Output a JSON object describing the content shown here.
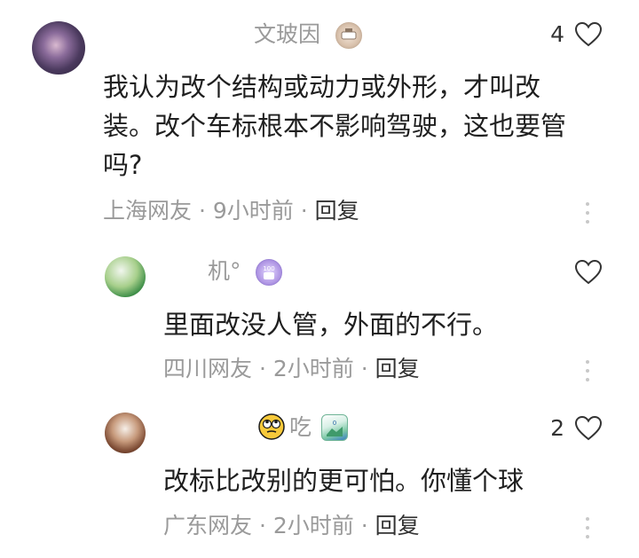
{
  "comments": [
    {
      "username": "文玻因",
      "badge_icon": "level-badge-icon",
      "like_count": "4",
      "content_lines": [
        "我认为改个结构或动力或外形，才叫改",
        "装。改个车标根本不影响驾驶，这也要管",
        "吗?"
      ],
      "location": "上海网友",
      "time": "9小时前",
      "reply_label": "回复"
    },
    {
      "username": "机°",
      "badge_icon": "level-badge-icon",
      "like_count": "",
      "content": "里面改没人管，外面的不行。",
      "location": "四川网友",
      "time": "2小时前",
      "reply_label": "回复"
    },
    {
      "username": "吃",
      "emoji": "🙄",
      "badge_icon": "level-badge-icon",
      "like_count": "2",
      "content": "改标比改别的更可怕。你懂个球",
      "location": "广东网友",
      "time": "2小时前",
      "reply_label": "回复"
    }
  ],
  "separator": " · "
}
